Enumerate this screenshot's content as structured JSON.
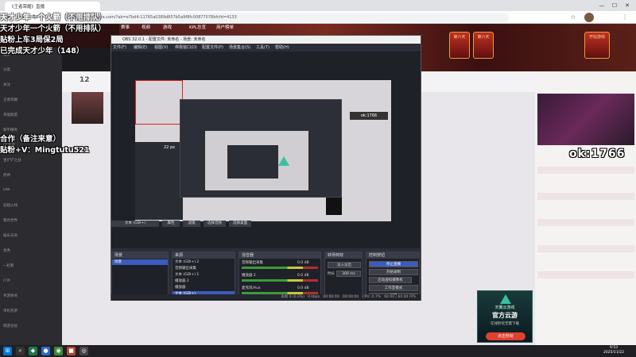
{
  "browser": {
    "tab_title": "《王者荣耀》直播",
    "url": "https://www.huya.com/?ab=e7bd4-11765a0389d857b5a9f8fc00877078bfcfd=4133",
    "minimize": "—",
    "maximize": "☐",
    "close": "✕"
  },
  "site": {
    "nav": [
      "赛事",
      "视频",
      "游戏",
      "KPL总览",
      "用户榜单"
    ],
    "game_tiles": [
      "第六天",
      "第六天",
      "开始游戏"
    ]
  },
  "overlay": {
    "line1": "天才少年一个火箭（不用排队）",
    "line2": "贴粉上车3局保2局",
    "line3": "已完成天才少年（148）",
    "line4": "合作（备注来意）",
    "line5": "贴粉+V：Mingtutu521"
  },
  "sidebar": {
    "items": [
      "推荐",
      "分类",
      "关注",
      "王者荣耀",
      "英雄联盟",
      "和平精英",
      "CF手游",
      "金铲铲之战",
      "原神",
      "DNF",
      "穿越火线",
      "我的世界",
      "娱乐天地",
      "星秀",
      "一起看",
      "户外",
      "手游休闲",
      "单机热游",
      "网游竞技"
    ]
  },
  "stream": {
    "viewer_count": "12",
    "danmaku_text": "ok:1766"
  },
  "obs": {
    "title": "OBS 32.0.1 - 配置文件: 未命名 - 场景: 未命名",
    "menu": [
      "文件(F)",
      "编辑(E)",
      "视图(V)",
      "停靠窗口(D)",
      "配置文件(P)",
      "场景集合(S)",
      "工具(T)",
      "帮助(H)"
    ],
    "preview_size": "22 px",
    "scene_tabs": [
      "文本 (GDI+)",
      "属性",
      "滤镜",
      "选择音频",
      "选择桌面"
    ],
    "scenes_header": "场景",
    "scenes": [
      "场景"
    ],
    "sources_header": "来源",
    "sources": [
      "文本 (GDI+) 2",
      "音频输出采集",
      "文本 (GDI+) 1",
      "播放器 2",
      "播放器",
      "文本 (GDI+)"
    ],
    "mixer_header": "混音器",
    "mixer": [
      {
        "name": "音频输出采集",
        "db": "0.0 dB"
      },
      {
        "name": "播放器 2",
        "db": "0.0 dB"
      },
      {
        "name": "麦克风/Aux",
        "db": "0.0 dB"
      }
    ],
    "transitions_header": "转场特效",
    "transition": "淡入淡出",
    "duration_label": "时长",
    "duration": "300 ms",
    "controls_header": "控制按钮",
    "controls": [
      "停止直播",
      "开始录制",
      "启动虚拟摄像机",
      "工作室模式",
      "设置"
    ],
    "status": [
      "丢帧 0 (0.0%)",
      "0 kbps",
      "00:00:00",
      "00:00:00",
      "CPU: 0.7%",
      "60.00 / 60.00 FPS"
    ]
  },
  "ad": {
    "brand": "天翼云游戏",
    "title": "官方云游",
    "sub": "在线秒玩无需下载",
    "button": "点击秒玩"
  },
  "taskbar": {
    "time": "9:53",
    "date": "2025/11/22"
  }
}
